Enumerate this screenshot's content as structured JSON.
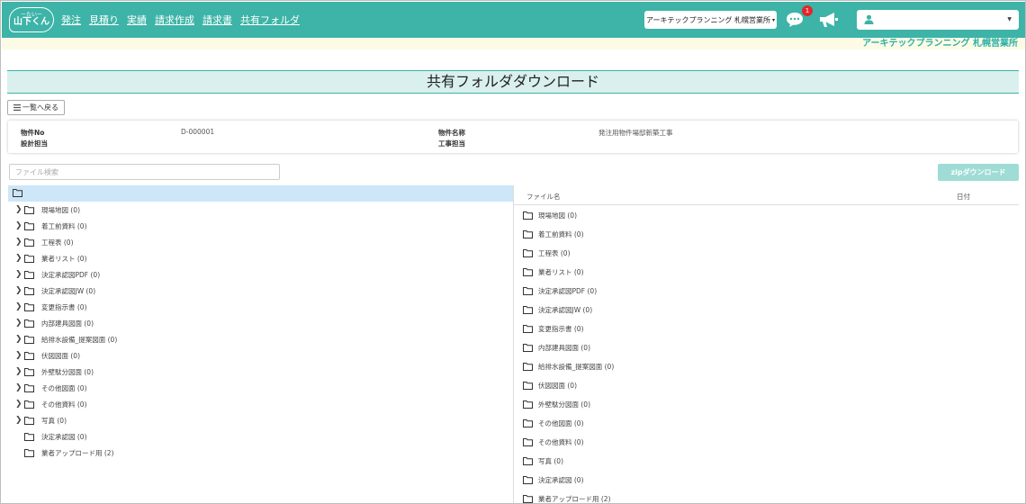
{
  "navbar": {
    "logo_top": "ーたいー",
    "logo_main": "山下くん",
    "menu": [
      "発注",
      "見積り",
      "実績",
      "請求作成",
      "請求書",
      "共有フォルダ"
    ],
    "company_selector": "アーキテックプランニング 札幌営業所",
    "notification_count": "1",
    "bg_color": "#3db4a7"
  },
  "subbar": {
    "office_name": "アーキテックプランニング 札幌営業所"
  },
  "page": {
    "title": "共有フォルダダウンロード",
    "back_button": "一覧へ戻る"
  },
  "info": {
    "property_no_label": "物件No",
    "property_no_value": "D-000001",
    "design_label": "設計担当",
    "property_name_label": "物件名称",
    "property_name_value": "発注用物件場邸新築工事",
    "construction_label": "工事担当"
  },
  "search": {
    "placeholder": "ファイル検索"
  },
  "zip_button": "zipダウンロード",
  "tree": {
    "items": [
      {
        "name": "現場地図 (0)",
        "expandable": true
      },
      {
        "name": "着工前資料 (0)",
        "expandable": true
      },
      {
        "name": "工程表 (0)",
        "expandable": true
      },
      {
        "name": "業者リスト (0)",
        "expandable": true
      },
      {
        "name": "決定承認図PDF (0)",
        "expandable": true
      },
      {
        "name": "決定承認図JW (0)",
        "expandable": true
      },
      {
        "name": "変更指示書 (0)",
        "expandable": true
      },
      {
        "name": "内部建具図面 (0)",
        "expandable": true
      },
      {
        "name": "給排水設備_提案図面 (0)",
        "expandable": true
      },
      {
        "name": "伏図図面 (0)",
        "expandable": true
      },
      {
        "name": "外壁駄分図面 (0)",
        "expandable": true
      },
      {
        "name": "その他図面 (0)",
        "expandable": true
      },
      {
        "name": "その他資料 (0)",
        "expandable": true
      },
      {
        "name": "写真 (0)",
        "expandable": true
      },
      {
        "name": "決定承認図 (0)",
        "expandable": false
      },
      {
        "name": "業者アップロード用 (2)",
        "expandable": false
      }
    ]
  },
  "file_list": {
    "header_name": "ファイル名",
    "header_date": "日付",
    "rows": [
      "現場地図 (0)",
      "着工前資料 (0)",
      "工程表 (0)",
      "業者リスト (0)",
      "決定承認図PDF (0)",
      "決定承認図JW (0)",
      "変更指示書 (0)",
      "内部建具図面 (0)",
      "給排水設備_提案図面 (0)",
      "伏図図面 (0)",
      "外壁駄分図面 (0)",
      "その他図面 (0)",
      "その他資料 (0)",
      "写真 (0)",
      "決定承認図 (0)",
      "業者アップロード用 (2)"
    ]
  }
}
